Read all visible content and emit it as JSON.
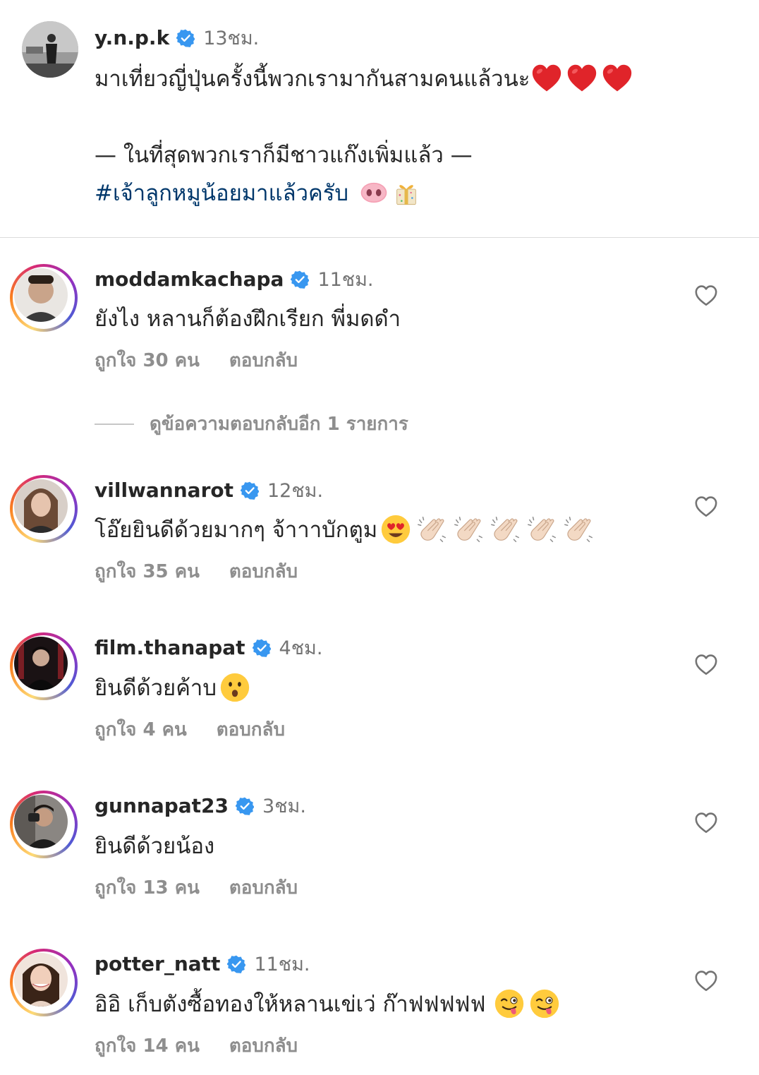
{
  "post": {
    "username": "y.n.p.k",
    "time": "13ชม.",
    "line1": "มาเที่ยวญี่ปุ่นครั้งนี้พวกเรามากันสามคนแล้วนะ",
    "line2": "— ในที่สุดพวกเราก็มีชาวแก๊งเพิ่มแล้ว —",
    "hashtag": "#เจ้าลูกหมูน้อยมาแล้วครับ"
  },
  "comments": [
    {
      "username": "moddamkachapa",
      "time": "11ชม.",
      "text": "ยังไง หลานก็ต้องฝึกเรียก พี่มดดำ",
      "likes": "ถูกใจ 30 คน",
      "reply": "ตอบกลับ",
      "avatar_color": "#c9a48a"
    },
    {
      "username": "villwannarot",
      "time": "12ชม.",
      "text": "โอ๊ยยินดีด้วยมากๆ จ้าาาบักตูม",
      "likes": "ถูกใจ 35 คน",
      "reply": "ตอบกลับ",
      "avatar_color": "#b89a8a"
    },
    {
      "username": "film.thanapat",
      "time": "4ชม.",
      "text": "ยินดีด้วยค้าบ",
      "likes": "ถูกใจ 4 คน",
      "reply": "ตอบกลับ",
      "avatar_color": "#2a1e22"
    },
    {
      "username": "gunnapat23",
      "time": "3ชม.",
      "text": "ยินดีด้วยน้อง",
      "likes": "ถูกใจ 13 คน",
      "reply": "ตอบกลับ",
      "avatar_color": "#6c6a66"
    },
    {
      "username": "potter_natt",
      "time": "11ชม.",
      "text": "อิอิ เก็บตังซื้อทองให้หลานเข่เว่ ก๊าฟฟฟฟฟ",
      "likes": "ถูกใจ 14 คน",
      "reply": "ตอบกลับ",
      "avatar_color": "#d8b4a4"
    }
  ],
  "view_replies": "ดูข้อความตอบกลับอีก 1 รายการ",
  "colors": {
    "verified": "#3897f0",
    "username": "#262626",
    "meta": "#8e8e8e",
    "hashtag": "#00376b",
    "divider": "#dbdbdb"
  },
  "icons": [
    "verified-badge-icon",
    "heart-outline-icon",
    "red-heart-emoji",
    "pig-nose-emoji",
    "gift-emoji",
    "heart-eyes-emoji",
    "clapping-hands-emoji",
    "surprised-face-emoji",
    "winking-tongue-emoji"
  ]
}
